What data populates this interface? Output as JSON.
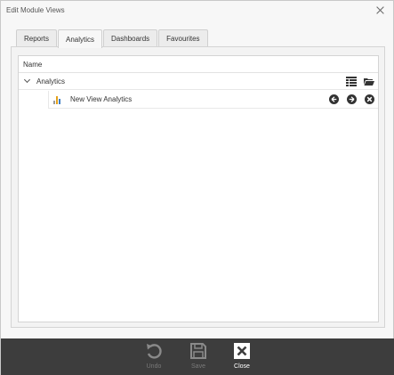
{
  "window": {
    "title": "Edit Module Views"
  },
  "tabs": [
    {
      "label": "Reports"
    },
    {
      "label": "Analytics",
      "active": true
    },
    {
      "label": "Dashboards"
    },
    {
      "label": "Favourites"
    }
  ],
  "grid": {
    "column_header": "Name",
    "group": {
      "label": "Analytics",
      "expanded": true,
      "actions": [
        "columns-icon",
        "open-folder-icon"
      ]
    },
    "items": [
      {
        "label": "New View Analytics",
        "icon": "bar-chart-icon",
        "actions": [
          "arrow-left-icon",
          "arrow-right-icon",
          "remove-icon"
        ]
      }
    ]
  },
  "footer": {
    "undo_label": "Undo",
    "save_label": "Save",
    "close_label": "Close"
  },
  "colors": {
    "footer_bg": "#3d3d3d",
    "disabled_text": "#7a7a7a",
    "chart_bars": [
      "#9a9a9a",
      "#e4a11b",
      "#3f7fc4"
    ]
  }
}
